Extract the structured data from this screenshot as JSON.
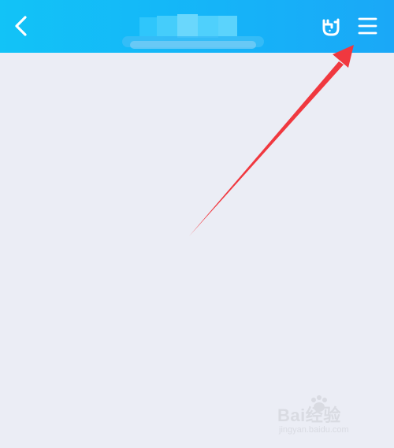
{
  "header": {
    "back_icon": "chevron-left-icon",
    "title_obscured": true,
    "actions": [
      {
        "icon": "hand-gesture-icon"
      },
      {
        "icon": "menu-icon"
      }
    ]
  },
  "annotation": {
    "type": "arrow",
    "color": "#f0383f",
    "points_to": "menu-icon"
  },
  "watermark": {
    "brand": "Bai经验",
    "url": "jingyan.baidu.com"
  },
  "colors": {
    "header_start": "#12c3f7",
    "header_end": "#1aa8f7",
    "background": "#ebedf5",
    "icon": "#ffffff"
  }
}
